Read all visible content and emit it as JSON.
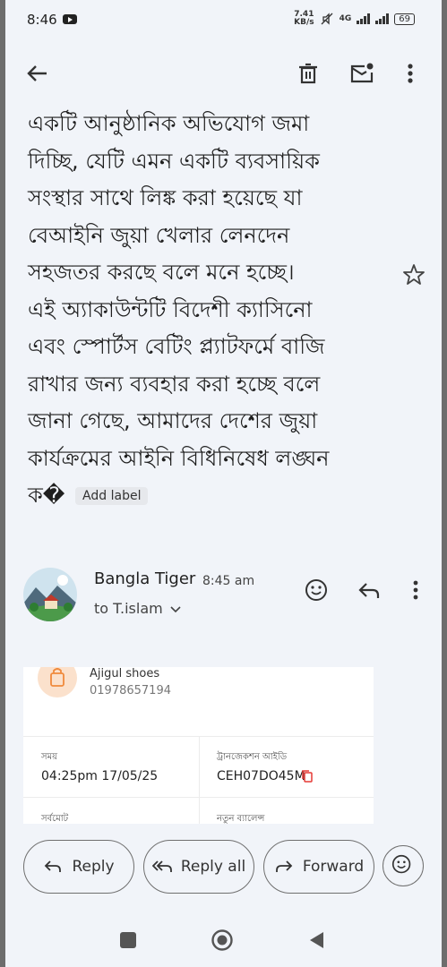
{
  "status_bar": {
    "time": "8:46",
    "net_speed_value": "7.41",
    "net_speed_unit": "KB/s",
    "network": "4G",
    "battery": "69"
  },
  "toolbar": {
    "back_icon": "arrow-left-icon",
    "delete_icon": "trash-icon",
    "mark_unread_icon": "mail-unread-icon",
    "more_icon": "more-vert-icon"
  },
  "email_body": {
    "lines": [
      "একটি আনুষ্ঠানিক অভিযোগ জমা",
      "দিচ্ছি, যেটি এমন একটি ব্যবসায়িক",
      "সংস্থার সাথে লিঙ্ক করা হয়েছে যা",
      "বেআইনি জুয়া খেলার লেনদেন",
      "সহজতর করছে বলে মনে হচ্ছে।",
      "এই অ্যাকাউন্টটি বিদেশী ক্যাসিনো",
      "এবং স্পোর্টস বেটিং প্ল্যাটফর্মে বাজি",
      "রাখার জন্য ব্যবহার করা হচ্ছে বলে",
      "জানা গেছে, আমাদের দেশের জুয়া",
      "কার্যক্রমের আইনি বিধিনিষেধ লঙ্ঘন"
    ],
    "last_line": "ক�",
    "add_label": "Add label"
  },
  "message": {
    "sender": "Bangla Tiger",
    "time": "8:45 am",
    "to": "to T.islam"
  },
  "receipt_card": {
    "merchant_name": "Ajigul shoes",
    "merchant_phone": "01978657194",
    "time_label": "সময়",
    "time_value": "04:25pm 17/05/25",
    "txn_label": "ট্রানজেকশন আইডি",
    "txn_value": "CEH07DO45M",
    "total_label": "সর্বমোট",
    "balance_label": "নতুন ব্যালেন্স"
  },
  "actions": {
    "reply": "Reply",
    "reply_all": "Reply all",
    "forward": "Forward"
  },
  "colors": {
    "background": "#f1f4f9",
    "copy_icon": "#e53935",
    "shop_icon_bg": "#fbe1cc"
  }
}
